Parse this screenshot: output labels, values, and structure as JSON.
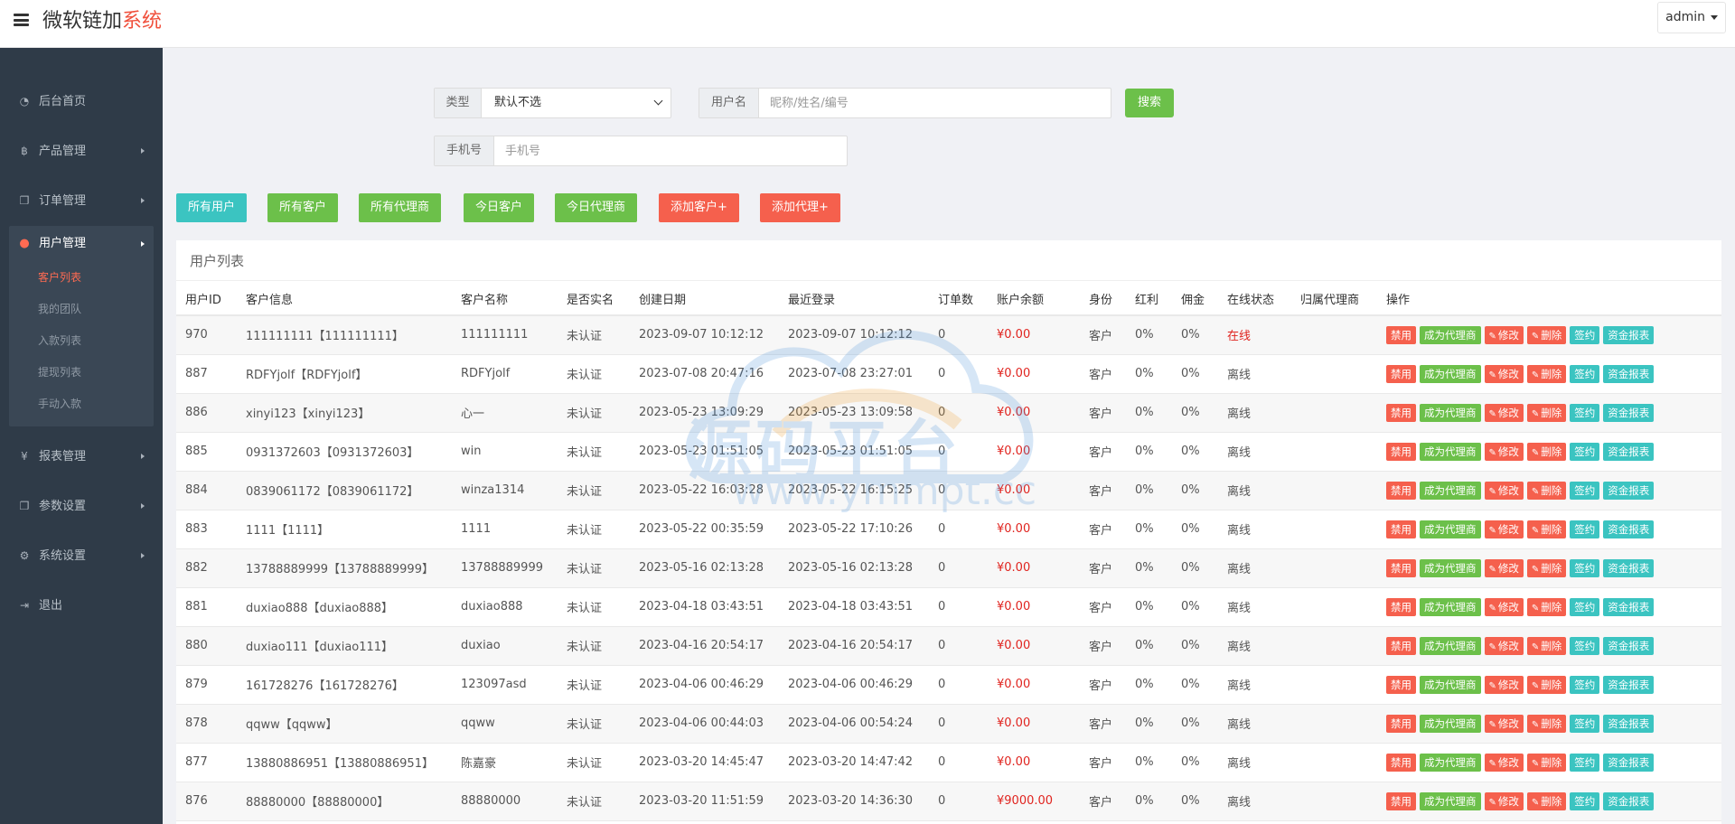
{
  "header": {
    "brand_main": "微软链加",
    "brand_accent": "系统",
    "user": "admin"
  },
  "sidebar": {
    "items": [
      {
        "label": "后台首页",
        "icon": "dashboard-icon"
      },
      {
        "label": "产品管理",
        "icon": "bitcoin-icon"
      },
      {
        "label": "订单管理",
        "icon": "copy-icon"
      },
      {
        "label": "报表管理",
        "icon": "yen-icon"
      },
      {
        "label": "参数设置",
        "icon": "copy-icon"
      },
      {
        "label": "系统设置",
        "icon": "gears-icon"
      },
      {
        "label": "退出",
        "icon": "sign-out-icon"
      }
    ],
    "active_group": {
      "label": "用户管理",
      "icon": "user-icon",
      "children": [
        "客户列表",
        "我的团队",
        "入款列表",
        "提现列表",
        "手动入款"
      ]
    }
  },
  "filters": {
    "type_label": "类型",
    "type_value": "默认不选",
    "username_label": "用户名",
    "username_placeholder": "昵称/姓名/编号",
    "search_label": "搜索",
    "phone_label": "手机号",
    "phone_placeholder": "手机号"
  },
  "actions": [
    "所有用户",
    "所有客户",
    "所有代理商",
    "今日客户",
    "今日代理商",
    "添加客户+",
    "添加代理+"
  ],
  "panel": {
    "title": "用户列表",
    "columns": [
      "用户ID",
      "客户信息",
      "客户名称",
      "是否实名",
      "创建日期",
      "最近登录",
      "订单数",
      "账户余额",
      "身份",
      "红利",
      "佣金",
      "在线状态",
      "归属代理商",
      "操作"
    ],
    "row_ops": [
      "禁用",
      "成为代理商",
      "修改",
      "删除",
      "签约",
      "资金报表"
    ],
    "rows": [
      [
        "970",
        "111111111【111111111】",
        "111111111",
        "未认证",
        "2023-09-07 10:12:12",
        "2023-09-07 10:12:12",
        "0",
        "¥0.00",
        "客户",
        "0%",
        "0%",
        "在线",
        ""
      ],
      [
        "887",
        "RDFYjolf【RDFYjolf】",
        "RDFYjolf",
        "未认证",
        "2023-07-08 20:47:16",
        "2023-07-08 23:27:01",
        "0",
        "¥0.00",
        "客户",
        "0%",
        "0%",
        "离线",
        ""
      ],
      [
        "886",
        "xinyi123【xinyi123】",
        "心一",
        "未认证",
        "2023-05-23 13:09:29",
        "2023-05-23 13:09:58",
        "0",
        "¥0.00",
        "客户",
        "0%",
        "0%",
        "离线",
        ""
      ],
      [
        "885",
        "0931372603【0931372603】",
        "win",
        "未认证",
        "2023-05-23 01:51:05",
        "2023-05-23 01:51:05",
        "0",
        "¥0.00",
        "客户",
        "0%",
        "0%",
        "离线",
        ""
      ],
      [
        "884",
        "0839061172【0839061172】",
        "winza1314",
        "未认证",
        "2023-05-22 16:03:28",
        "2023-05-22 16:15:25",
        "0",
        "¥0.00",
        "客户",
        "0%",
        "0%",
        "离线",
        ""
      ],
      [
        "883",
        "1111【1111】",
        "1111",
        "未认证",
        "2023-05-22 00:35:59",
        "2023-05-22 17:10:26",
        "0",
        "¥0.00",
        "客户",
        "0%",
        "0%",
        "离线",
        ""
      ],
      [
        "882",
        "13788889999【13788889999】",
        "13788889999",
        "未认证",
        "2023-05-16 02:13:28",
        "2023-05-16 02:13:28",
        "0",
        "¥0.00",
        "客户",
        "0%",
        "0%",
        "离线",
        ""
      ],
      [
        "881",
        "duxiao888【duxiao888】",
        "duxiao888",
        "未认证",
        "2023-04-18 03:43:51",
        "2023-04-18 03:43:51",
        "0",
        "¥0.00",
        "客户",
        "0%",
        "0%",
        "离线",
        ""
      ],
      [
        "880",
        "duxiao111【duxiao111】",
        "duxiao",
        "未认证",
        "2023-04-16 20:54:17",
        "2023-04-16 20:54:17",
        "0",
        "¥0.00",
        "客户",
        "0%",
        "0%",
        "离线",
        ""
      ],
      [
        "879",
        "161728276【161728276】",
        "123097asd",
        "未认证",
        "2023-04-06 00:46:29",
        "2023-04-06 00:46:29",
        "0",
        "¥0.00",
        "客户",
        "0%",
        "0%",
        "离线",
        ""
      ],
      [
        "878",
        "qqww【qqww】",
        "qqww",
        "未认证",
        "2023-04-06 00:44:03",
        "2023-04-06 00:54:24",
        "0",
        "¥0.00",
        "客户",
        "0%",
        "0%",
        "离线",
        ""
      ],
      [
        "877",
        "13880886951【13880886951】",
        "陈嘉豪",
        "未认证",
        "2023-03-20 14:45:47",
        "2023-03-20 14:47:42",
        "0",
        "¥0.00",
        "客户",
        "0%",
        "0%",
        "离线",
        ""
      ],
      [
        "876",
        "88880000【88880000】",
        "88880000",
        "未认证",
        "2023-03-20 11:51:59",
        "2023-03-20 14:36:30",
        "0",
        "¥9000.00",
        "客户",
        "0%",
        "0%",
        "离线",
        ""
      ]
    ]
  },
  "watermark": {
    "text": "源码平台",
    "url": "www.ymmpt.cc"
  },
  "colors": {
    "sidebar": "#2f3b48",
    "accent_red": "#f5604d",
    "green": "#6cc04a",
    "teal": "#3bc4c1",
    "money_red": "#e0241f"
  }
}
